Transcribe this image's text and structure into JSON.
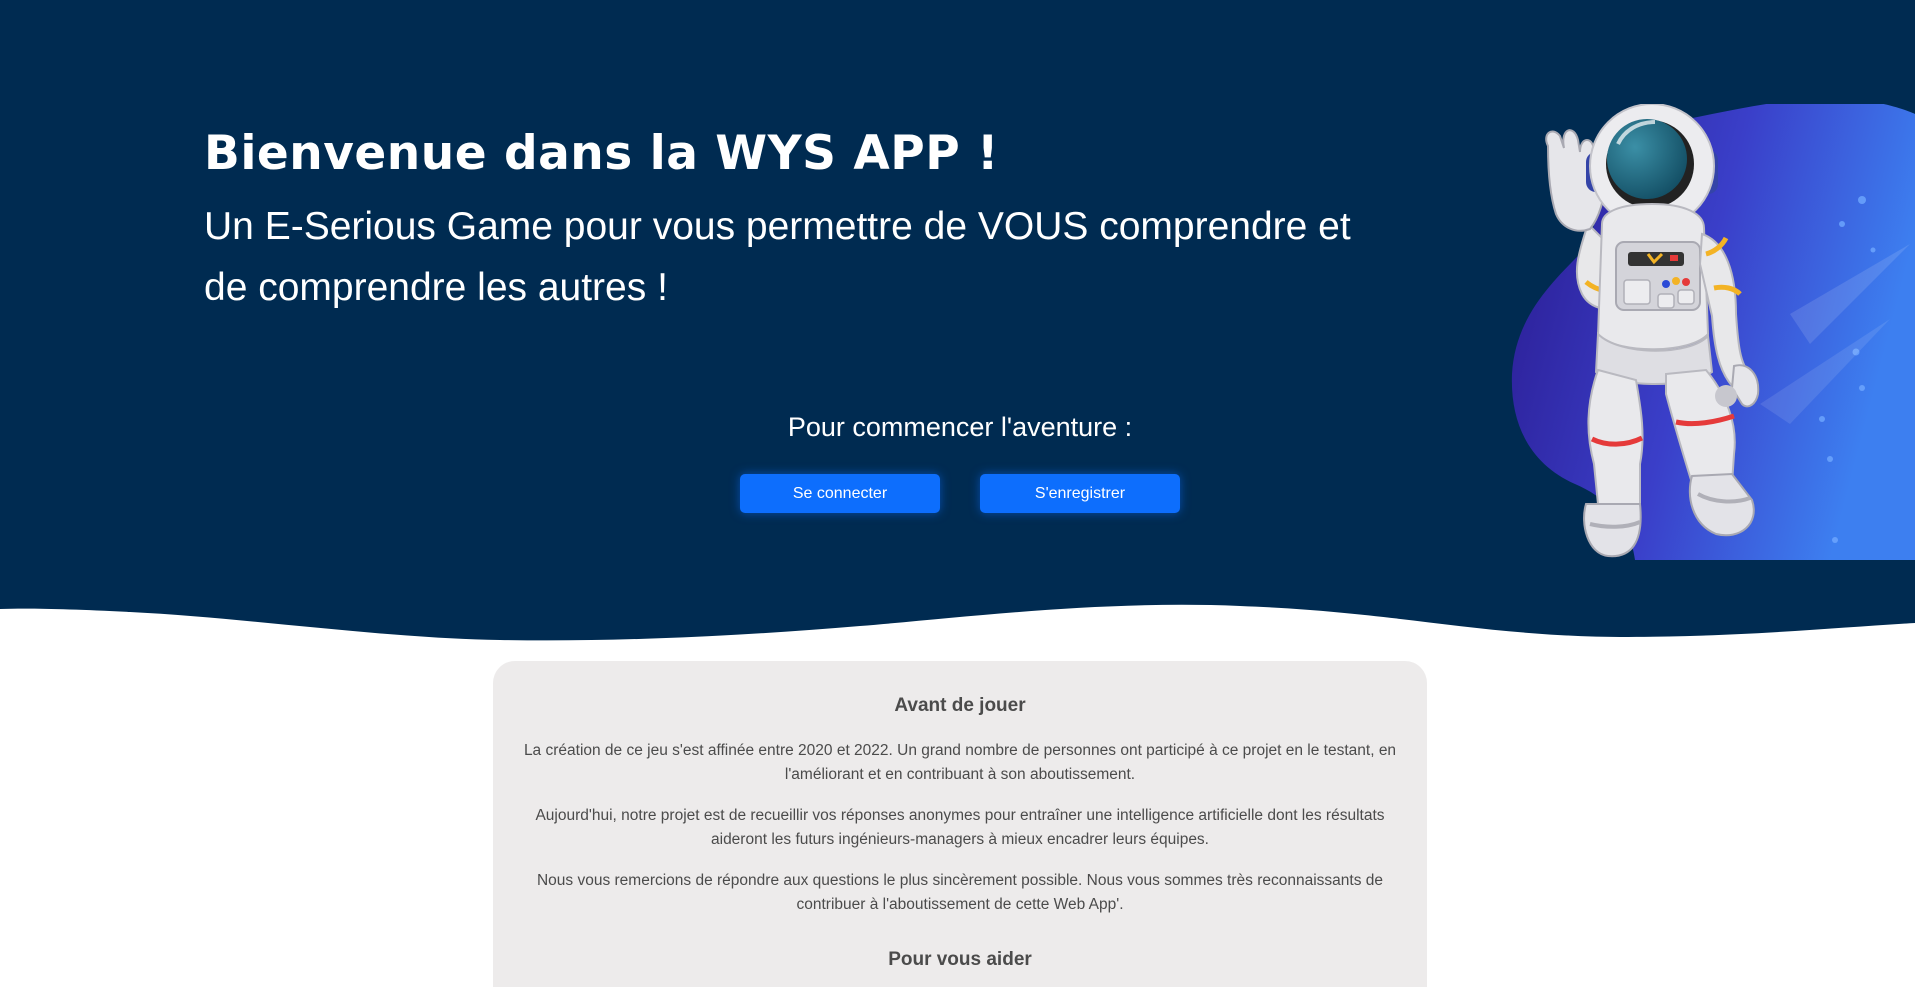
{
  "hero": {
    "title": "Bienvenue dans la WYS APP !",
    "subtitle": "Un E-Serious Game pour vous permettre de VOUS comprendre et de comprendre les autres !",
    "cta_label": "Pour commencer l'aventure :",
    "login_button": "Se connecter",
    "register_button": "S'enregistrer",
    "illustration": "astronaut-illustration"
  },
  "card": {
    "heading": "Avant de jouer",
    "paragraphs": [
      "La création de ce jeu s'est affinée entre 2020 et 2022. Un grand nombre de personnes ont participé à ce projet en le testant, en l'améliorant et en contribuant à son aboutissement.",
      "Aujourd'hui, notre projet est de recueillir vos réponses anonymes pour entraîner une intelligence artificielle dont les résultats aideront les futurs ingénieurs-managers à mieux encadrer leurs équipes.",
      "Nous vous remercions de répondre aux questions le plus sincèrement possible. Nous vous sommes très reconnaissants de contribuer à l'aboutissement de cette Web App'."
    ],
    "subheading": "Pour vous aider"
  },
  "colors": {
    "hero_background": "#002b51",
    "button": "#0d6efd",
    "card_background": "#edebeb",
    "text_dark": "#4b4b4b"
  }
}
